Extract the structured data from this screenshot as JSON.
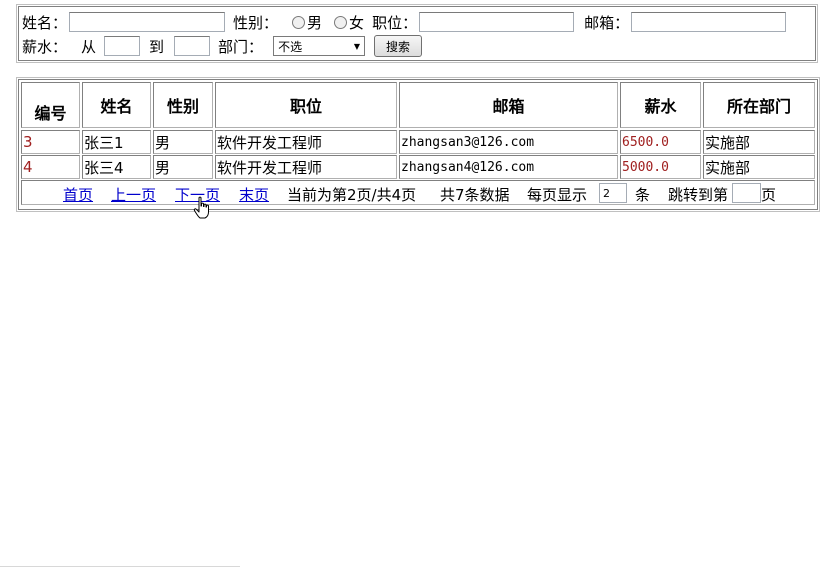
{
  "search": {
    "name_label": "姓名：",
    "name_value": "",
    "gender_label": "性别：",
    "gender_male": "男",
    "gender_female": "女",
    "position_label": "职位：",
    "position_value": "",
    "email_label": "邮箱：",
    "email_value": "",
    "salary_label": "薪水：",
    "from_label": "从",
    "salary_from": "",
    "to_label": "到",
    "salary_to": "",
    "dept_label": "部门：",
    "dept_selected": "不选",
    "search_button": "搜索"
  },
  "table": {
    "headers": [
      "编号",
      "姓名",
      "性别",
      "职位",
      "邮箱",
      "薪水",
      "所在部门"
    ],
    "rows": [
      [
        "3",
        "张三1",
        "男",
        "软件开发工程师",
        "zhangsan3@126.com",
        "6500.0",
        "实施部"
      ],
      [
        "4",
        "张三4",
        "男",
        "软件开发工程师",
        "zhangsan4@126.com",
        "5000.0",
        "实施部"
      ]
    ]
  },
  "pager": {
    "first": "首页",
    "prev": "上一页",
    "next": "下一页",
    "last": "末页",
    "current": "当前为第2页/共4页",
    "total": "共7条数据",
    "per_page_label": "每页显示",
    "per_page_value": "2",
    "per_page_unit": "条",
    "jump_label": "跳转到第",
    "jump_value": "",
    "jump_unit": "页"
  }
}
